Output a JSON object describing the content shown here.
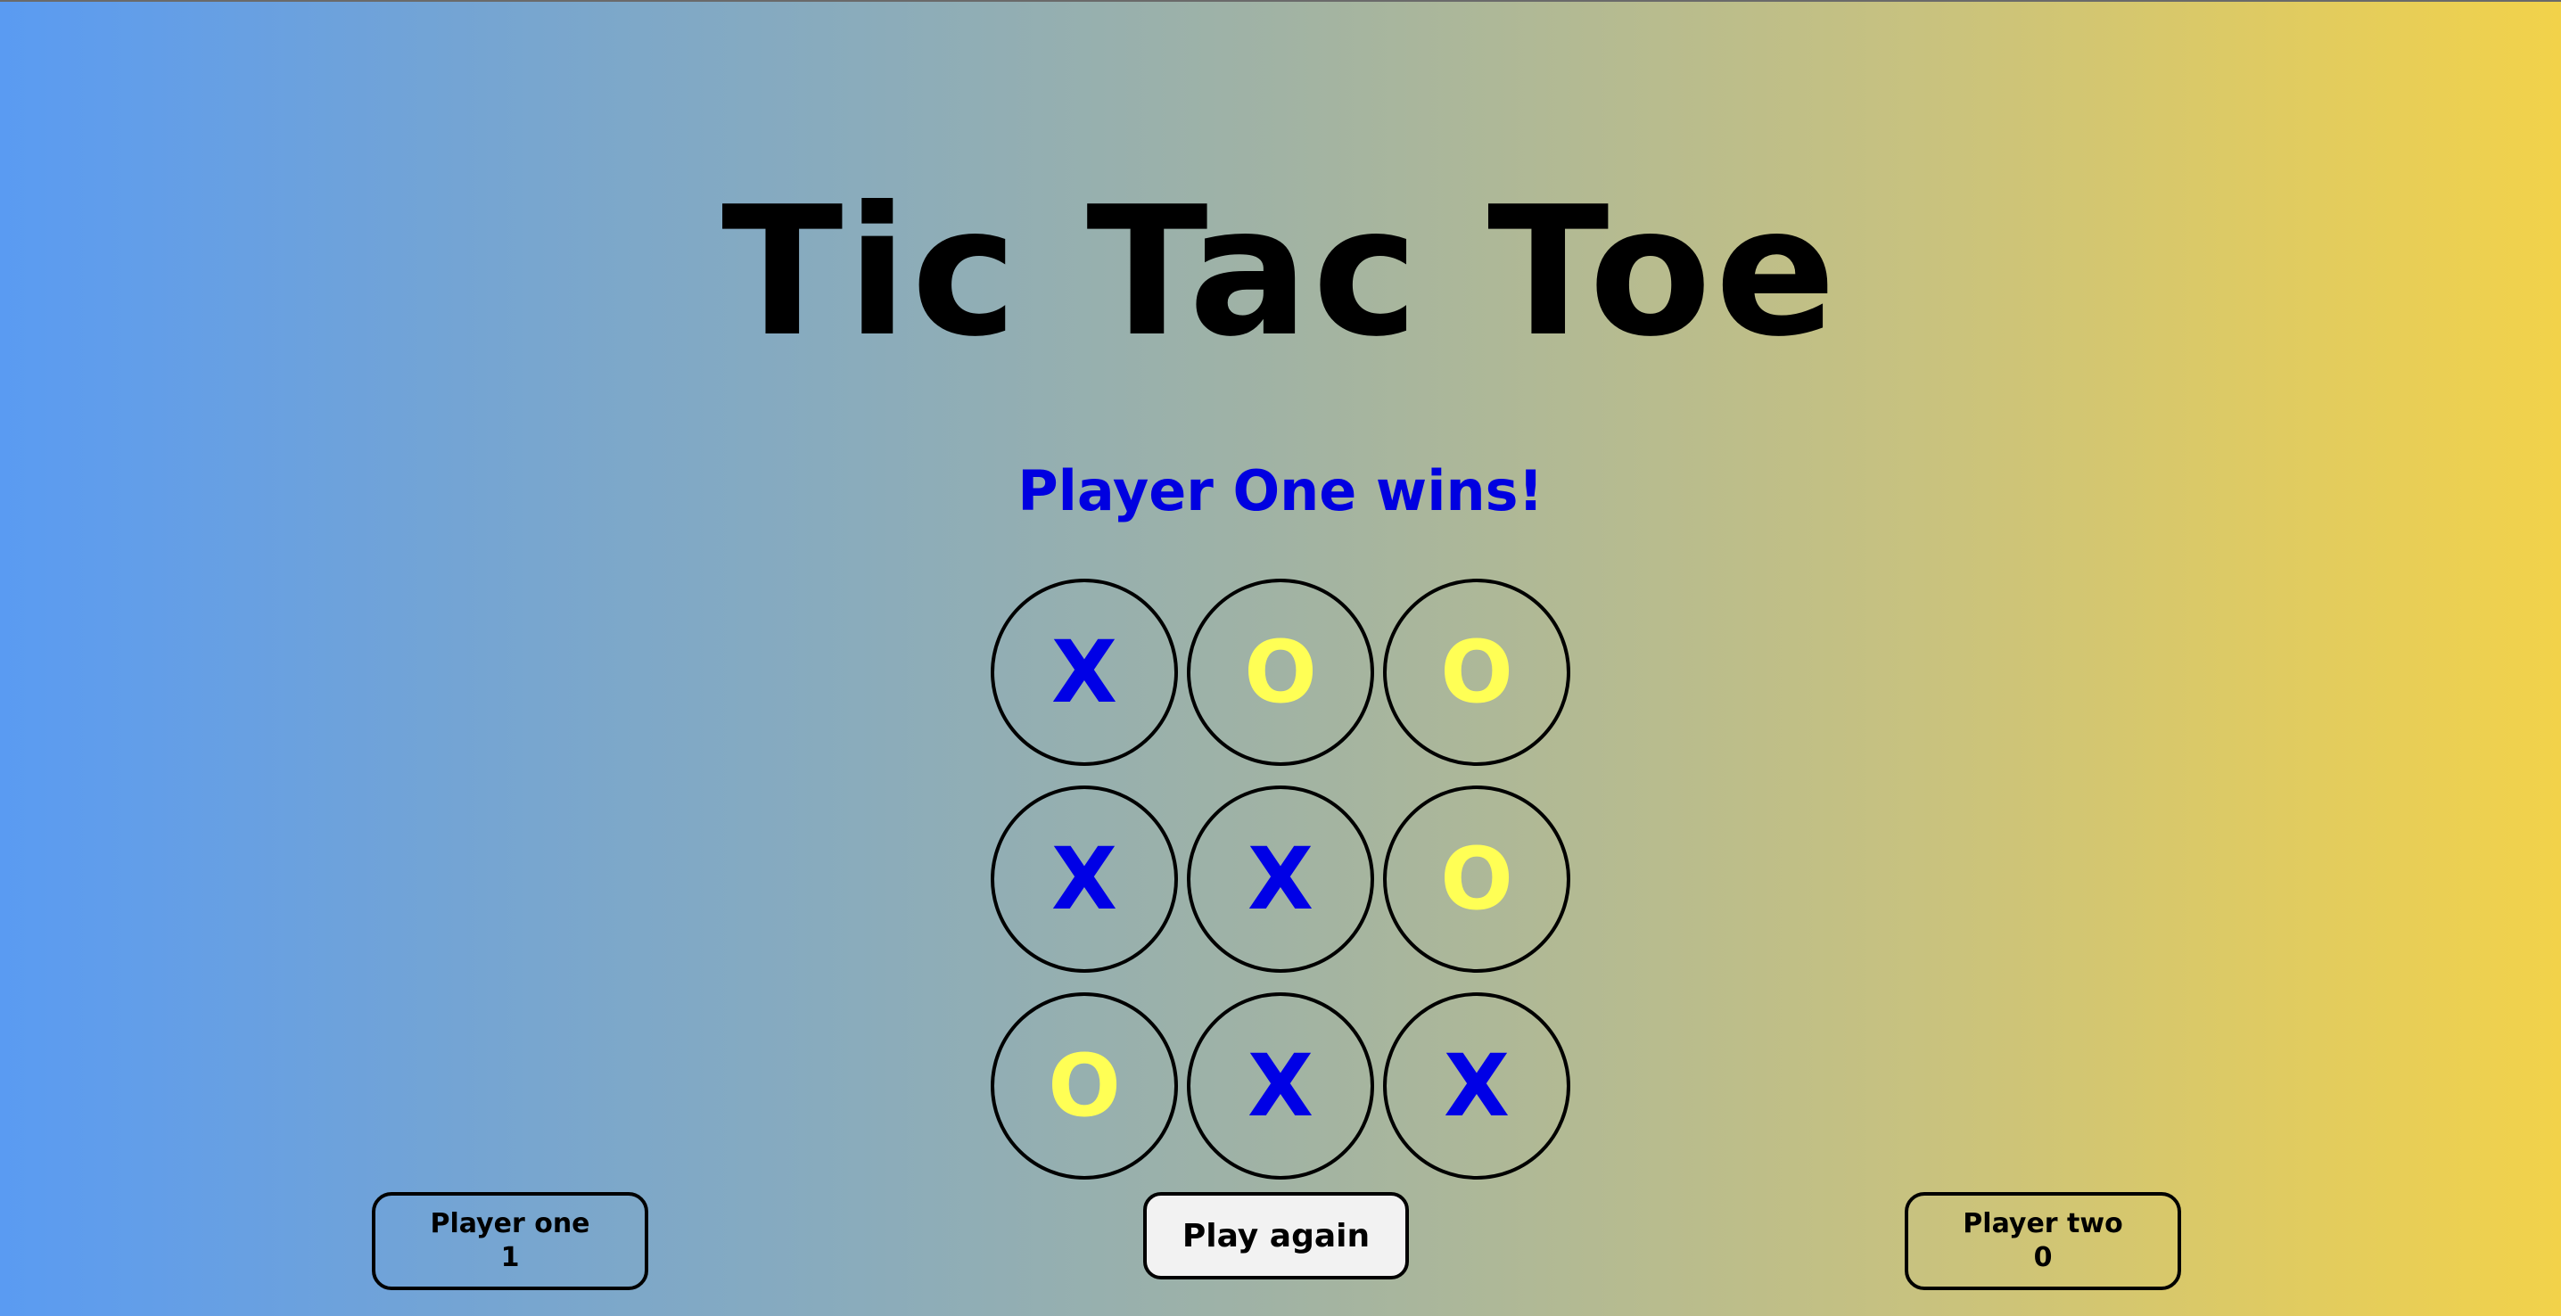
{
  "title": "Tic Tac Toe",
  "status": "Player One wins!",
  "board": {
    "cells": [
      "X",
      "O",
      "O",
      "X",
      "X",
      "O",
      "O",
      "X",
      "X"
    ]
  },
  "scores": {
    "player_one": {
      "label": "Player one",
      "value": "1"
    },
    "player_two": {
      "label": "Player two",
      "value": "0"
    }
  },
  "play_again_label": "Play again",
  "colors": {
    "x_mark": "#0000e6",
    "o_mark": "#ffff55",
    "status_text": "#0000e0",
    "gradient_left": "#5a9bf2",
    "gradient_right": "#f2d24a"
  }
}
